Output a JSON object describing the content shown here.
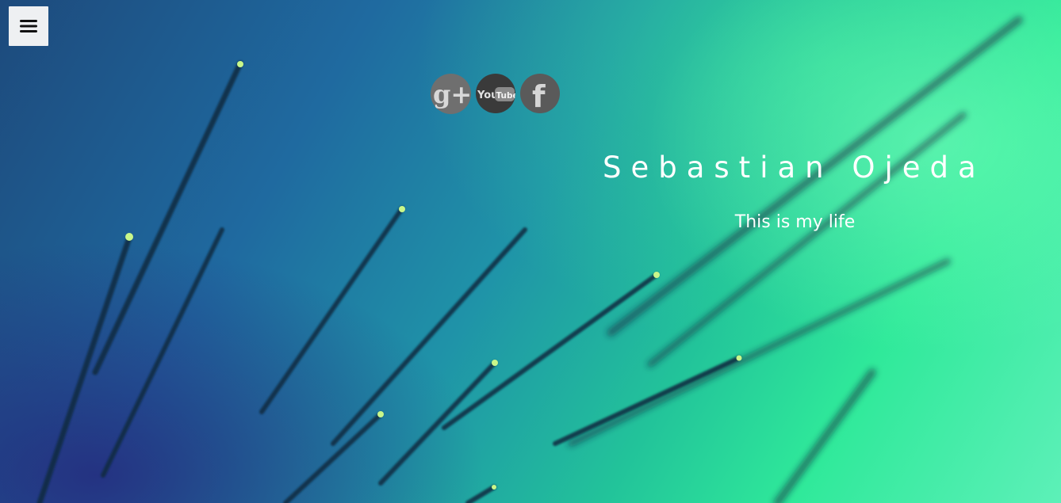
{
  "nav": {
    "menu_icon": "hamburger-menu-icon"
  },
  "social": [
    {
      "name": "google-plus",
      "icon": "google-plus-icon",
      "glyph": "g+"
    },
    {
      "name": "youtube",
      "icon": "youtube-icon",
      "glyph_you": "You",
      "glyph_tube": "Tube"
    },
    {
      "name": "facebook",
      "icon": "facebook-icon",
      "glyph": "f"
    }
  ],
  "hero": {
    "title": "Sebastian Ojeda",
    "tagline": "This is my life"
  },
  "colors": {
    "text": "#ffffff",
    "menu_bg": "#eef0f2",
    "accent_green": "#2fe99a",
    "deep_blue": "#1d4a7c"
  }
}
